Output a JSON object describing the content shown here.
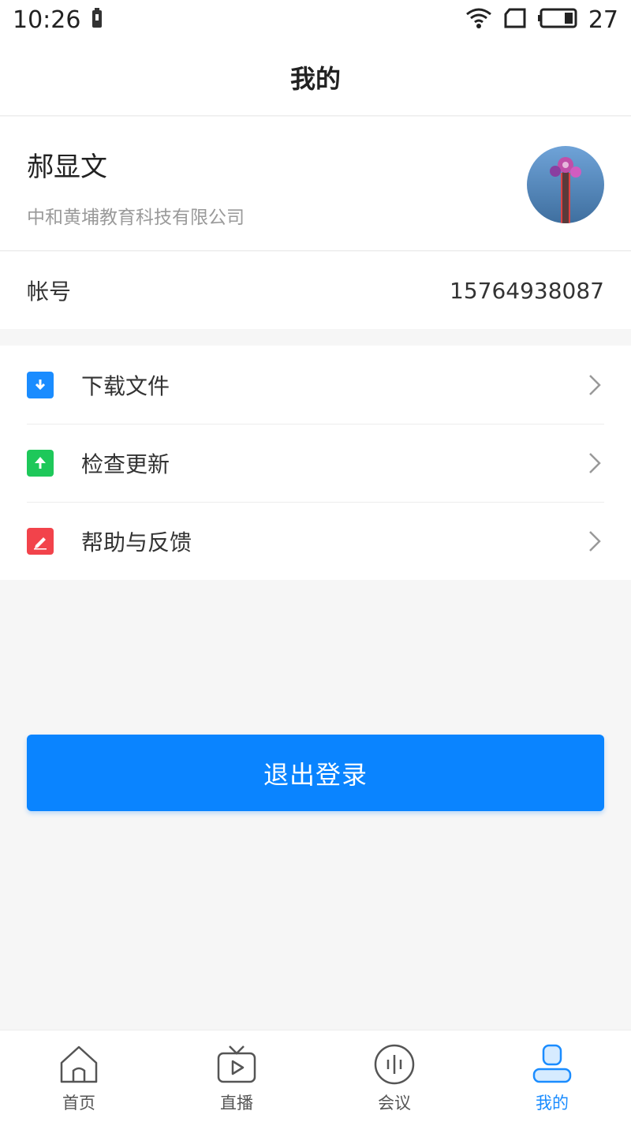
{
  "status_bar": {
    "time": "10:26",
    "battery_percent": "27"
  },
  "header": {
    "title": "我的"
  },
  "profile": {
    "name": "郝显文",
    "company": "中和黄埔教育科技有限公司"
  },
  "account": {
    "label": "帐号",
    "value": "15764938087"
  },
  "menu": {
    "items": [
      {
        "label": "下载文件",
        "icon": "download-folder-icon",
        "color": "#1a8cff"
      },
      {
        "label": "检查更新",
        "icon": "upload-arrow-icon",
        "color": "#1ec85a"
      },
      {
        "label": "帮助与反馈",
        "icon": "edit-pen-icon",
        "color": "#f2434b"
      }
    ]
  },
  "logout": {
    "label": "退出登录",
    "color": "#0a84ff"
  },
  "tabs": [
    {
      "label": "首页",
      "icon": "home-icon",
      "active": false
    },
    {
      "label": "直播",
      "icon": "tv-play-icon",
      "active": false
    },
    {
      "label": "会议",
      "icon": "meeting-wave-icon",
      "active": false
    },
    {
      "label": "我的",
      "icon": "user-icon",
      "active": true
    }
  ],
  "colors": {
    "accent": "#1a8cff",
    "background": "#f6f6f6",
    "text": "#333333",
    "subtext": "#9a9a9a"
  }
}
